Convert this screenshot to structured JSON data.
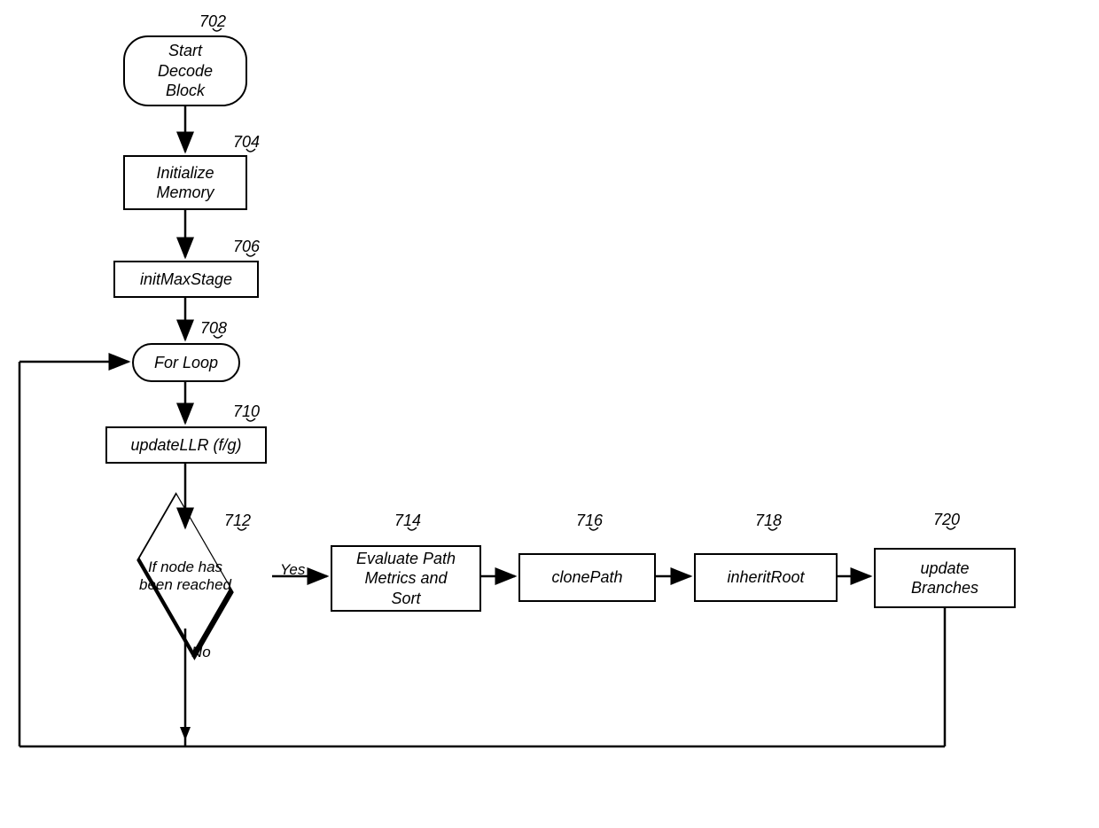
{
  "nodes": {
    "start": {
      "id": "702",
      "text": "Start\nDecode\nBlock"
    },
    "init_mem": {
      "id": "704",
      "text": "Initialize\nMemory"
    },
    "init_max": {
      "id": "706",
      "text": "initMaxStage"
    },
    "for_loop": {
      "id": "708",
      "text": "For Loop"
    },
    "update_llr": {
      "id": "710",
      "text": "updateLLR (f/g)"
    },
    "decision": {
      "id": "712",
      "text": "If node has\nbeen reached"
    },
    "eval_path": {
      "id": "714",
      "text": "Evaluate Path\nMetrics and\nSort"
    },
    "clone_path": {
      "id": "716",
      "text": "clonePath"
    },
    "inherit": {
      "id": "718",
      "text": "inheritRoot"
    },
    "update_br": {
      "id": "720",
      "text": "update\nBranches"
    }
  },
  "edges": {
    "yes": "Yes",
    "no": "No"
  }
}
